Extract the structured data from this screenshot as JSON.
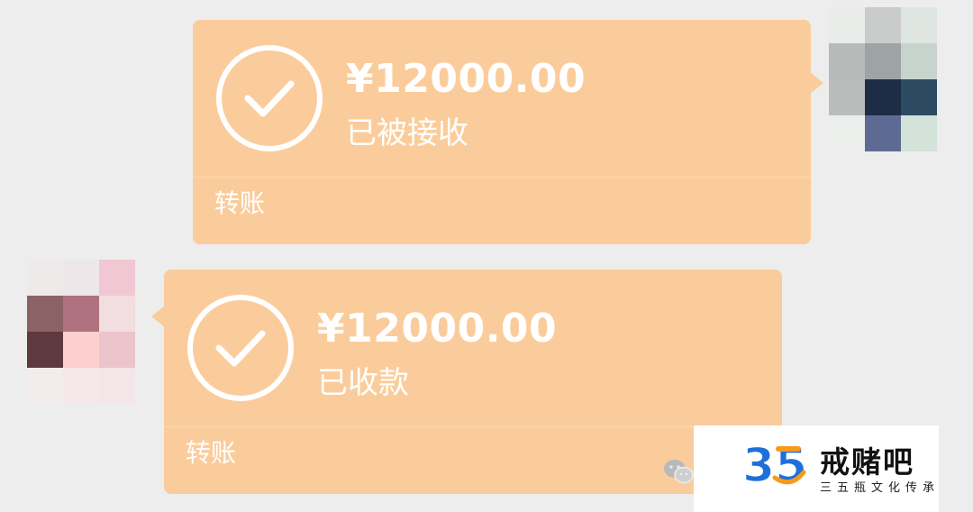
{
  "messages": [
    {
      "side": "sent",
      "amount": "¥12000.00",
      "status": "已被接收",
      "footer": "转账"
    },
    {
      "side": "received",
      "amount": "¥12000.00",
      "status": "已收款",
      "footer": "转账"
    }
  ],
  "watermark": {
    "logo_digits": "35",
    "name": "戒赌吧",
    "tagline": "三五瓶文化传承"
  },
  "colors": {
    "background": "#ededed",
    "transfer_bubble": "#fbcc9b",
    "bubble_text": "#ffffff",
    "logo_blue": "#1e6fd9",
    "logo_orange": "#f59b1a"
  },
  "icons": {
    "status": "check-circle-icon",
    "wechat": "wechat-icon"
  }
}
